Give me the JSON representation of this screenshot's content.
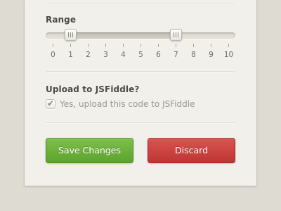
{
  "range": {
    "label": "Range",
    "min": 0,
    "max": 10,
    "low_value": 1,
    "high_value": 7,
    "ticks": [
      "0",
      "1",
      "2",
      "3",
      "4",
      "5",
      "6",
      "7",
      "8",
      "9",
      "10"
    ]
  },
  "upload": {
    "label": "Upload to JSFiddle?",
    "checkbox_label": "Yes, upload this code to JSFiddle",
    "checked": true
  },
  "buttons": {
    "save_label": "Save Changes",
    "discard_label": "Discard"
  },
  "colors": {
    "save_green": "#6bb23c",
    "discard_red": "#c9403c",
    "card_background": "#f2f0ea"
  }
}
